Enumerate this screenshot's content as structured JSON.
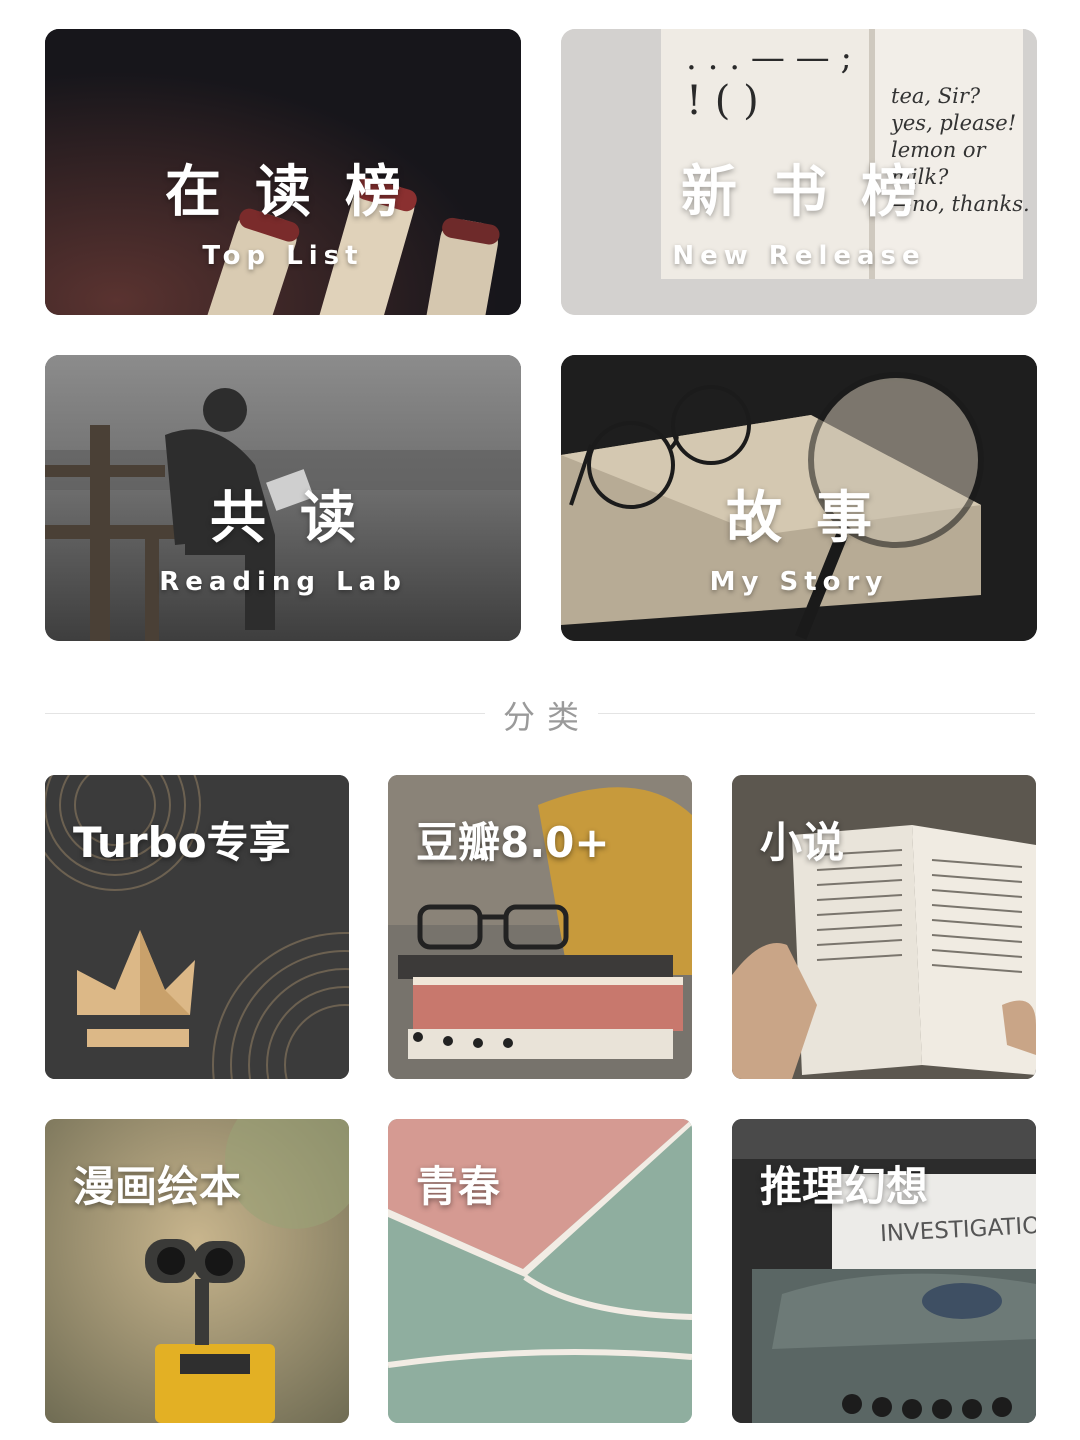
{
  "featured": [
    {
      "title": "在读榜",
      "subtitle": "Top List"
    },
    {
      "title": "新书榜",
      "subtitle": "New Release",
      "book_text": [
        "tea, Sir?",
        "yes, please!",
        "lemon or",
        "milk?",
        "—no, thanks."
      ]
    },
    {
      "title": "共读",
      "subtitle": "Reading Lab"
    },
    {
      "title": "故事",
      "subtitle": "My Story"
    }
  ],
  "section": {
    "label": "分类"
  },
  "categories": [
    {
      "label": "Turbo专享",
      "icon": "crown-icon"
    },
    {
      "label": "豆瓣8.0+"
    },
    {
      "label": "小说"
    },
    {
      "label": "漫画绘本"
    },
    {
      "label": "青春"
    },
    {
      "label": "推理幻想",
      "image_text": "INVESTIGATIO"
    }
  ]
}
